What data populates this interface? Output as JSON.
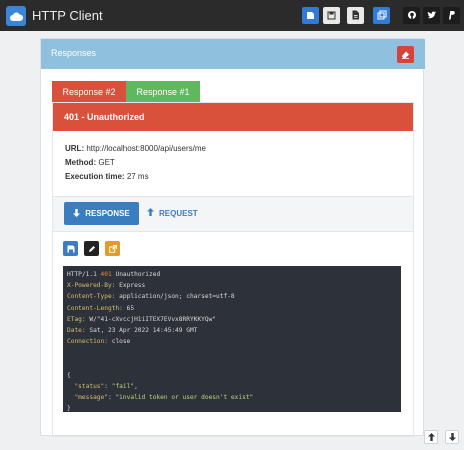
{
  "app": {
    "title": "HTTP Client"
  },
  "panel": {
    "title": "Responses"
  },
  "tabs": [
    {
      "label": "Response #2",
      "active": true
    },
    {
      "label": "Response #1",
      "active": false
    }
  ],
  "response": {
    "status": "401 - Unauthorized",
    "url_label": "URL:",
    "url": "http://localhost:8000/api/users/me",
    "method_label": "Method:",
    "method": "GET",
    "time_label": "Execution time:",
    "time": "27 ms"
  },
  "actions": {
    "response_label": "RESPONSE",
    "request_label": "REQUEST"
  },
  "raw": {
    "status_line": "HTTP/1.1",
    "status_code": "401",
    "status_reason": "Unauthorized",
    "headers": [
      {
        "key": "X-Powered-By:",
        "value": "Express"
      },
      {
        "key": "Content-Type:",
        "value": "application/json; charset=utf-8"
      },
      {
        "key": "Content-Length:",
        "value": "65"
      },
      {
        "key": "ETag:",
        "value": "W/\"41-cXvccjH1iITEX7EVvx8RRYKKYQw\""
      },
      {
        "key": "Date:",
        "value": "Sat, 23 Apr 2022 14:45:49 GMT"
      },
      {
        "key": "Connection:",
        "value": "close"
      }
    ],
    "body_open": "{",
    "body": [
      {
        "key": "\"status\"",
        "value": "\"fail\""
      },
      {
        "key": "\"message\"",
        "value": "\"invalid token or user doesn't exist\""
      }
    ],
    "body_close": "}"
  },
  "colors": {
    "accent": "#3a7ebf",
    "error": "#d9503b",
    "success": "#5fb85f",
    "panel_header": "#8fc1de"
  },
  "icons": [
    "cloud-icon",
    "save-icon",
    "disk-icon",
    "document-icon",
    "copy-icon",
    "github-icon",
    "twitter-icon",
    "paypal-icon",
    "eraser-icon",
    "arrow-down-icon",
    "arrow-up-icon",
    "floppy-icon",
    "edit-icon",
    "external-link-icon"
  ]
}
